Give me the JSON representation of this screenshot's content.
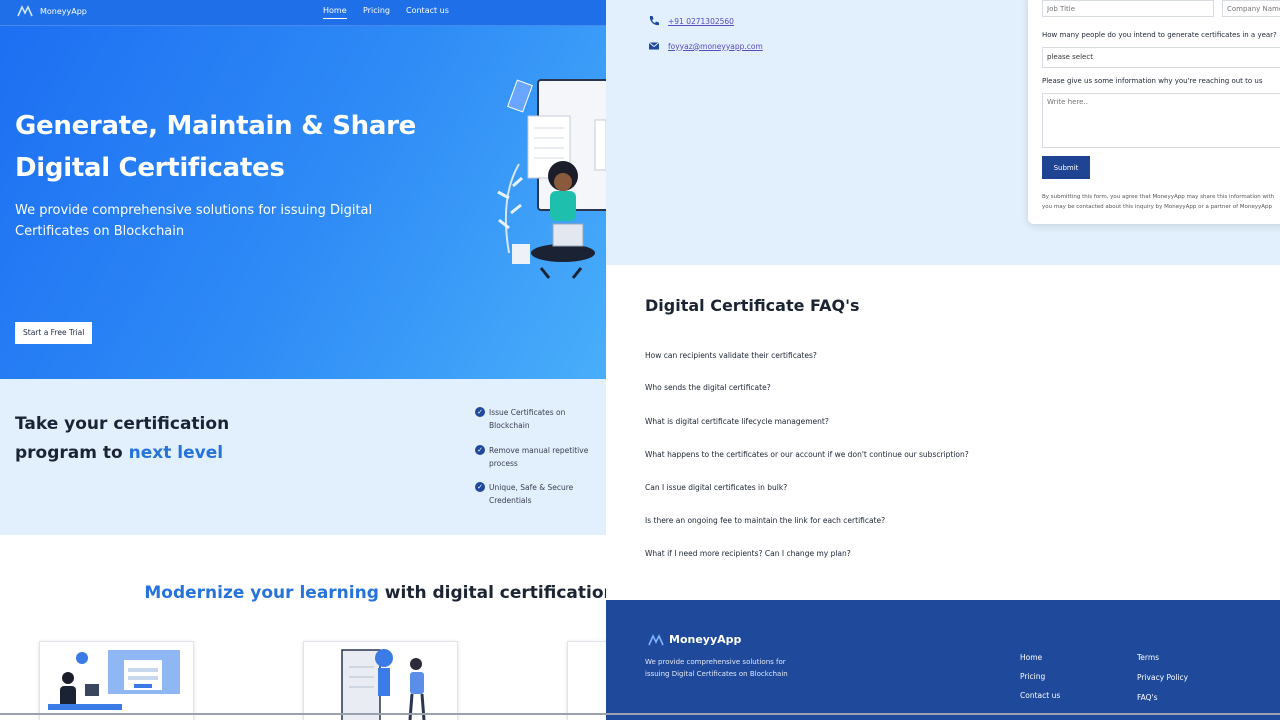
{
  "nav": {
    "brand": "MoneyyApp",
    "links": [
      "Home",
      "Pricing",
      "Contact us"
    ]
  },
  "hero": {
    "title": "Generate, Maintain & Share Digital Certificates",
    "subtitle": "We provide comprehensive solutions for issuing Digital Certificates on Blockchain",
    "cta": "Start a Free Trial"
  },
  "level": {
    "heading_part1": "Take your certification program to ",
    "heading_accent": "next level",
    "features": [
      "Issue Certificates on Blockchain",
      "Remove manual repetitive process",
      "Unique, Safe & Secure Credentials"
    ]
  },
  "modernize": {
    "prefix": "Modernize your learning",
    "suffix": " with digital certification"
  },
  "contact": {
    "phone": "+91 0271302560",
    "email": "foyyaz@moneyyapp.com"
  },
  "form": {
    "job_title_placeholder": "Job Title",
    "company_placeholder": "Company Name",
    "count_question": "How many people do you intend to generate certificates in a year?",
    "count_selected": "please select",
    "reason_question": "Please give us some information why you're reaching out to us",
    "reason_placeholder": "Write here..",
    "submit": "Submit",
    "disclaimer_line1": "By submitting this form, you agree that MoneyyApp may share this information with",
    "disclaimer_line2": "you may be contacted about this inquiry by MoneyyApp or a partner of MoneyyApp"
  },
  "faq": {
    "title": "Digital Certificate FAQ's",
    "questions": [
      "How can recipients validate their certificates?",
      "Who sends the digital certificate?",
      "What is digital certificate lifecycle management?",
      "What happens to the certificates or our account if we don't continue our subscription?",
      "Can I issue digital certificates in bulk?",
      "Is there an ongoing fee to maintain the link for each certificate?",
      "What if I need more recipients? Can I change my plan?"
    ]
  },
  "footer": {
    "brand": "MoneyyApp",
    "description": "We provide comprehensive solutions for issuing Digital Certificates on Blockchain",
    "links_col1": [
      "Home",
      "Pricing",
      "Contact us"
    ],
    "links_col2": [
      "Terms",
      "Privacy Policy",
      "FAQ's"
    ]
  },
  "colors": {
    "primary": "#1c6ef2",
    "navy": "#1f4a9c",
    "accent_text": "#2673d9",
    "light_bg": "#e2effc"
  },
  "icons": [
    "logo-mark-icon",
    "phone-icon",
    "mail-icon",
    "check-circle-icon",
    "chevron-down-icon"
  ]
}
